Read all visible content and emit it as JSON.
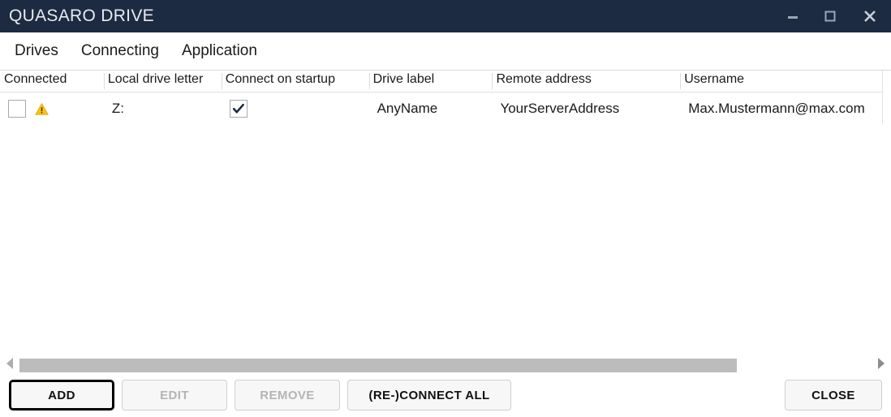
{
  "window": {
    "title": "QUASARO DRIVE",
    "controls": [
      {
        "name": "minimize",
        "label": "Minimize"
      },
      {
        "name": "maximize",
        "label": "Maximize"
      },
      {
        "name": "close",
        "label": "Close"
      }
    ]
  },
  "menu": {
    "items": [
      {
        "label": "Drives"
      },
      {
        "label": "Connecting"
      },
      {
        "label": "Application"
      }
    ]
  },
  "table": {
    "columns": [
      {
        "key": "connected",
        "label": "Connected"
      },
      {
        "key": "local_drive_letter",
        "label": "Local drive letter"
      },
      {
        "key": "connect_on_startup",
        "label": "Connect on startup"
      },
      {
        "key": "drive_label",
        "label": "Drive label"
      },
      {
        "key": "remote_address",
        "label": "Remote address"
      },
      {
        "key": "username",
        "label": "Username"
      }
    ],
    "rows": [
      {
        "connected": false,
        "status_icon": "warning-icon",
        "local_drive_letter": "Z:",
        "connect_on_startup": true,
        "drive_label": "AnyName",
        "remote_address": "YourServerAddress",
        "username": "Max.Mustermann@max.com"
      }
    ]
  },
  "scrollbar": {
    "left_arrow": "chevron-left-icon",
    "right_arrow": "chevron-right-icon",
    "thumb_fraction": "0.842"
  },
  "buttons": {
    "add": {
      "label": "ADD",
      "enabled": true,
      "focused": true
    },
    "edit": {
      "label": "EDIT",
      "enabled": false
    },
    "remove": {
      "label": "REMOVE",
      "enabled": false
    },
    "reconnect_all": {
      "label": "(RE-)CONNECT ALL",
      "enabled": true
    },
    "close": {
      "label": "CLOSE",
      "enabled": true
    }
  },
  "colors": {
    "titlebar": "#1c2b42",
    "titlebar_text": "#e8eaee",
    "warning": "#ffc20e",
    "checkmark": "#1c2b42",
    "scroll_thumb": "#bcbcbc",
    "disabled_text": "#b4b4b4"
  }
}
